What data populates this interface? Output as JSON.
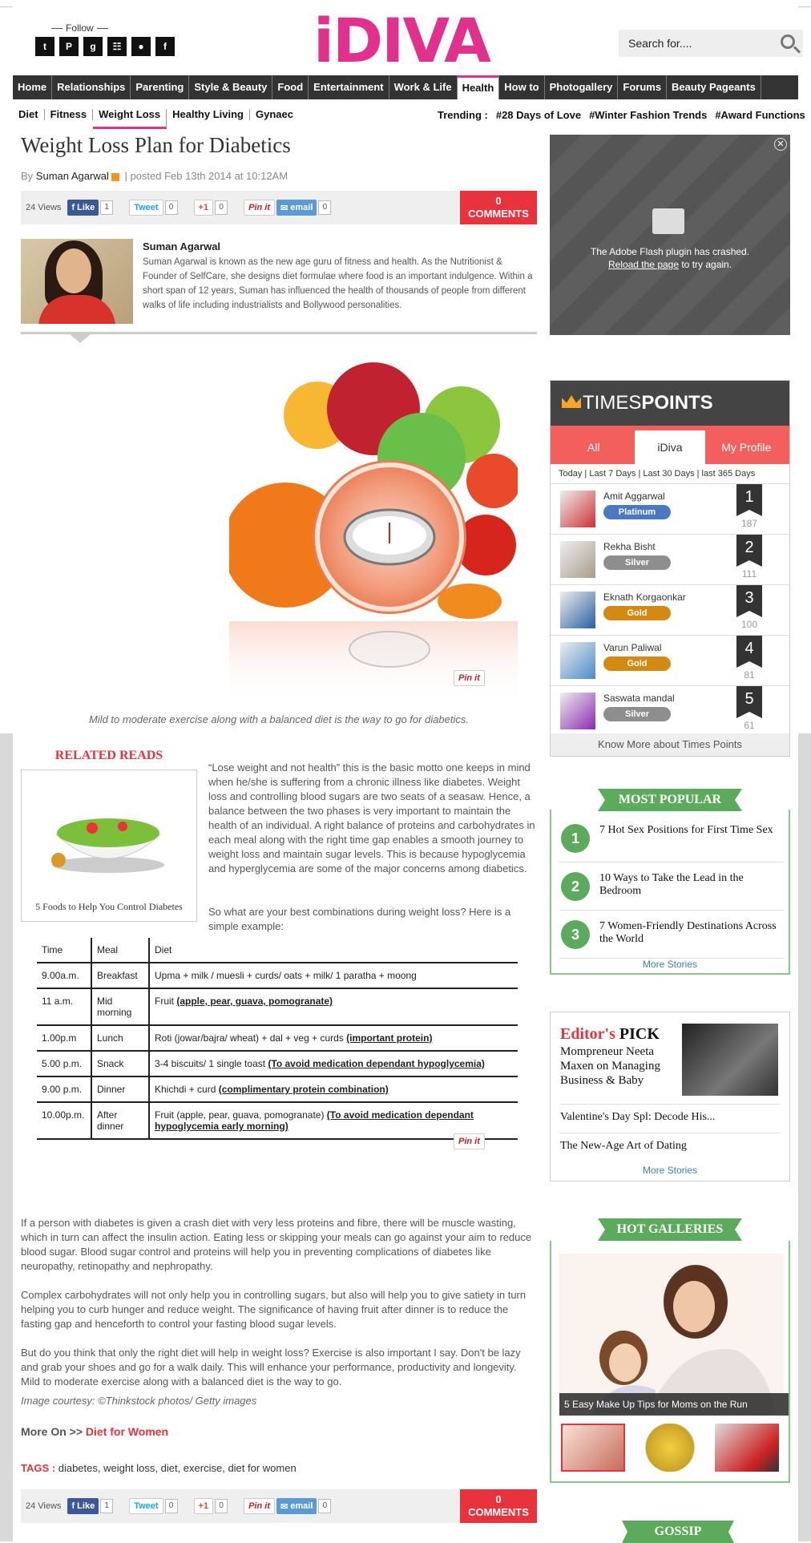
{
  "header": {
    "follow_label": "Follow",
    "social_icons": [
      "tumblr-icon",
      "pinterest-icon",
      "google-plus-icon",
      "rss-icon",
      "orkut-icon",
      "facebook-icon"
    ],
    "social_glyphs": [
      "t",
      "P",
      "g",
      "☷",
      "●",
      "f"
    ],
    "logo": "iDIVA",
    "search_placeholder": "Search for....",
    "brand_color": "#e2318c"
  },
  "nav": {
    "items": [
      "Home",
      "Relationships",
      "Parenting",
      "Style & Beauty",
      "Food",
      "Entertainment",
      "Work & Life",
      "Health",
      "How to",
      "Photogallery",
      "Forums",
      "Beauty Pageants"
    ],
    "active": "Health"
  },
  "subnav": {
    "items": [
      "Diet",
      "Fitness",
      "Weight Loss",
      "Healthy Living",
      "Gynaec"
    ],
    "active": "Weight Loss"
  },
  "trending": {
    "label": "Trending :",
    "items": [
      "#28 Days of Love",
      "#Winter Fashion Trends",
      "#Award Functions"
    ]
  },
  "article": {
    "title": "Weight Loss Plan for Diabetics",
    "by": "By",
    "author": "Suman Agarwal",
    "posted": "| posted Feb 13th 2014 at 10:12AM",
    "share": {
      "views": "24 Views",
      "like": "Like",
      "like_count": "1",
      "tweet": "Tweet",
      "tweet_count": "0",
      "gplus": "+1",
      "gplus_count": "0",
      "pin": "Pin it",
      "email": "email",
      "email_count": "0",
      "comments_count": "0",
      "comments_label": "COMMENTS"
    },
    "author_box": {
      "name": "Suman Agarwal",
      "bio": "Suman Agarwal is known as the new age guru of fitness and health. As the Nutritionist & Founder of SelfCare, she designs diet formulae where food is an important indulgence. Within a short span of 12 years, Suman has  influenced the health of thousands of people from different walks of life including industrialists and Bollywood personalities."
    },
    "hero_pin": "Pin it",
    "caption": "Mild to moderate exercise along with a balanced diet is the way to go for diabetics.",
    "related": {
      "heading": "RELATED READS",
      "title": "5 Foods to Help You Control Diabetes"
    },
    "para1": "“Lose weight and not health” this is the basic motto one keeps in mind when he/she is suffering from a chronic illness like diabetes. Weight loss and controlling blood sugars are two seats of a seasaw. Hence, a balance between the two phases is very important to maintain the health of an individual. A right balance of proteins and carbohydrates in each meal along with the right time gap enables a smooth journey to weight loss and maintain sugar levels. This is because hypoglycemia and hyperglycemia are some of the major concerns among diabetics.",
    "para2": "So what are your best combinations during weight loss? Here is a simple example:",
    "table": {
      "headers": [
        "Time",
        "Meal",
        "Diet"
      ],
      "rows": [
        {
          "time": "9.00a.m.",
          "meal": "Breakfast",
          "diet": "Upma + milk / muesli + curds/ oats + milk/ 1 paratha + moong",
          "note": ""
        },
        {
          "time": "11 a.m.",
          "meal": "Mid morning",
          "diet": "Fruit ",
          "note": "(apple, pear, guava, pomogranate)"
        },
        {
          "time": "1.00p.m",
          "meal": "Lunch",
          "diet": "Roti (jowar/bajra/ wheat) + dal + veg + curds ",
          "note": "(important protein)"
        },
        {
          "time": "5.00 p.m.",
          "meal": "Snack",
          "diet": "3-4 biscuits/ 1 single toast ",
          "note": "(To avoid medication dependant hypoglycemia)"
        },
        {
          "time": "9.00 p.m.",
          "meal": "Dinner",
          "diet": "Khichdi + curd ",
          "note": "(complimentary protein combination)"
        },
        {
          "time": "10.00p.m.",
          "meal": "After dinner",
          "diet": "Fruit   (apple, pear, guava, pomogranate) ",
          "note": "(To avoid medication dependant hypoglycemia early morning)"
        }
      ],
      "pin": "Pin it"
    },
    "para3": "If a person with diabetes is given a crash diet with very less proteins and fibre, there will be muscle wasting, which in turn can affect the insulin action. Eating less or skipping your meals can go against your aim to reduce blood sugar. Blood sugar control and proteins will help you in preventing complications of diabetes like neuropathy, retinopathy and nephropathy.",
    "para4": "Complex carbohydrates will not only help you in controlling sugars, but also will help you to give satiety in turn helping you to curb hunger and reduce weight. The significance of having fruit after dinner is to reduce the fasting gap and henceforth to control your fasting blood sugar levels.",
    "para5": "But do you think that only the right diet will help in weight loss? Exercise is also important I say. Don't be lazy and grab your shoes and go for a walk daily. This will enhance your performance, productivity and longevity. Mild to moderate exercise along with a balanced diet is the way to go.",
    "courtesy": "Image courtesy: ©Thinkstock photos/ Getty images",
    "more_on_label": "More On >>",
    "more_on_link": "Diet for Women",
    "tags_label": "TAGS :",
    "tags": "diabetes, weight loss, diet, exercise, diet for women"
  },
  "sidebar": {
    "flash": {
      "line1": "The Adobe Flash plugin has crashed.",
      "reload": "Reload the page",
      "line2": " to try again.",
      "close": "✕"
    },
    "timespoints": {
      "brand_a": "TIMES",
      "brand_b": "POINTS",
      "tabs": [
        "All",
        "iDiva",
        "My Profile"
      ],
      "active_tab": "iDiva",
      "periods": "Today  |  Last 7 Days  |  Last 30 Days  |  last 365 Days",
      "users": [
        {
          "name": "Amit Aggarwal",
          "badge": "Platinum",
          "rank": "1",
          "points": "187",
          "color": "#4a78c4"
        },
        {
          "name": "Rekha Bisht",
          "badge": "Silver",
          "rank": "2",
          "points": "111",
          "color": "#8e8e8e"
        },
        {
          "name": "Eknath Korgaonkar",
          "badge": "Gold",
          "rank": "3",
          "points": "100",
          "color": "#d48a12"
        },
        {
          "name": "Varun Paliwal",
          "badge": "Gold",
          "rank": "4",
          "points": "81",
          "color": "#d48a12"
        },
        {
          "name": "Saswata mandal",
          "badge": "Silver",
          "rank": "5",
          "points": "61",
          "color": "#8e8e8e"
        }
      ],
      "know_more": "Know More about Times Points"
    },
    "most_popular": {
      "heading": "MOST POPULAR",
      "items": [
        {
          "num": "1",
          "text": "7 Hot Sex Positions for First Time Sex"
        },
        {
          "num": "2",
          "text": "10 Ways to Take the Lead in the Bedroom"
        },
        {
          "num": "3",
          "text": "7 Women-Friendly Destinations Across the World"
        }
      ],
      "more": "More Stories"
    },
    "editors_pick": {
      "heading_a": "Editor's",
      "heading_b": " PICK",
      "lead": "Mompreneur Neeta Maxen on Managing Business & Baby",
      "stories": [
        "Valentine's Day Spl: Decode His...",
        "The New-Age Art of Dating"
      ],
      "more": "More Stories"
    },
    "hot_galleries": {
      "heading": "HOT GALLERIES",
      "caption": "5 Easy Make Up Tips for Moms on the Run"
    },
    "gossip": "GOSSIP"
  }
}
